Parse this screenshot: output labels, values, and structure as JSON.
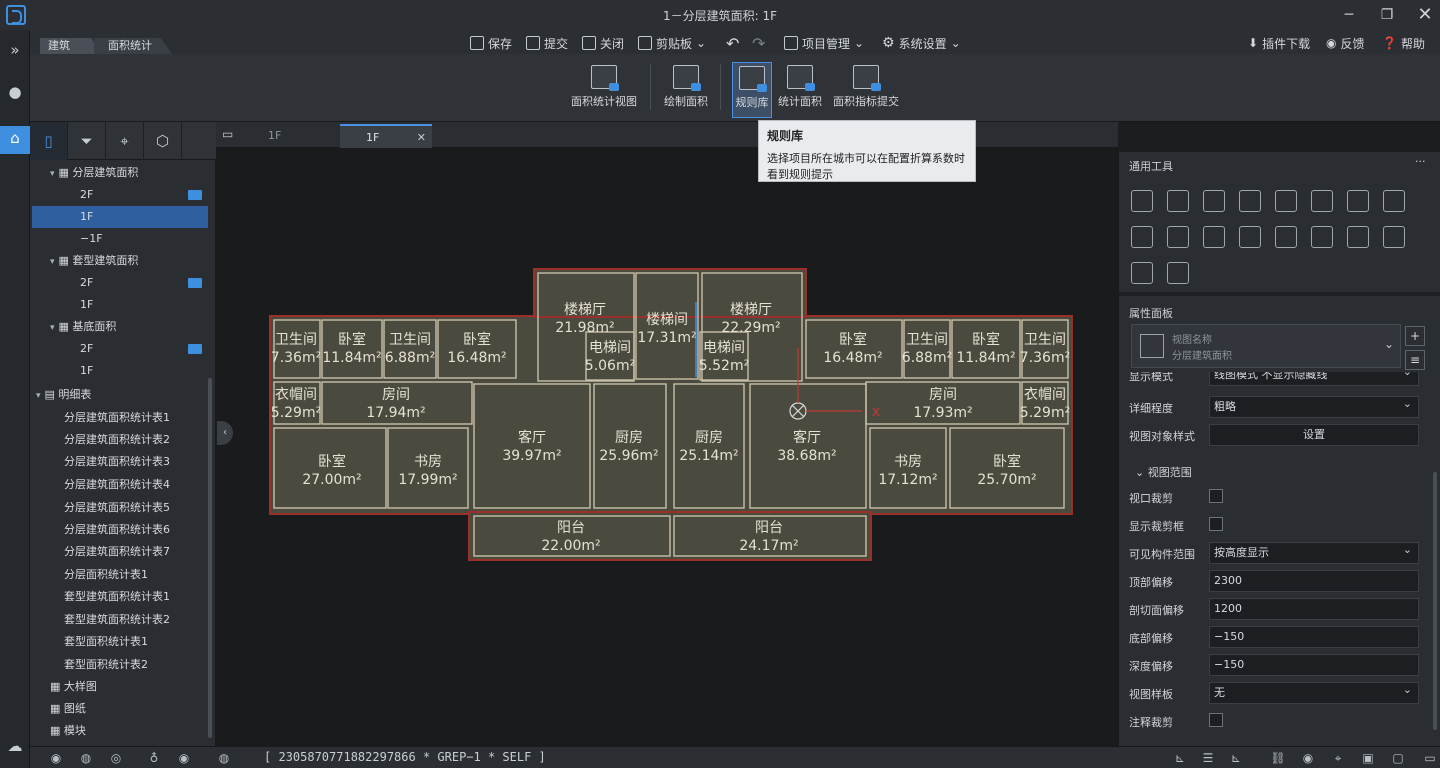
{
  "window": {
    "title": "1－分层建筑面积: 1F"
  },
  "breadcrumb": {
    "arch": "建筑",
    "area": "面积统计"
  },
  "toolbar": {
    "save": "保存",
    "submit": "提交",
    "close": "关闭",
    "clipboard": "剪贴板",
    "project": "项目管理",
    "settings": "系统设置",
    "plugin": "插件下载",
    "feedback": "反馈",
    "help": "帮助"
  },
  "ribbon": {
    "area_view": "面积统计视图",
    "draw_area": "绘制面积",
    "rules": "规则库",
    "stat_area": "统计面积",
    "submit_index": "面积指标提交"
  },
  "tooltip": {
    "title": "规则库",
    "body": "选择项目所在城市可以在配置折算系数时看到规则提示"
  },
  "tree": {
    "layer_area": "分层建筑面积",
    "l_2f": "2F",
    "l_1f": "1F",
    "l_m1f": "−1F",
    "unit_area": "套型建筑面积",
    "u_2f": "2F",
    "u_1f": "1F",
    "base_area": "基底面积",
    "b_2f": "2F",
    "b_1f": "1F",
    "schedule": "明细表",
    "sch": [
      "分层建筑面积统计表1",
      "分层建筑面积统计表2",
      "分层建筑面积统计表3",
      "分层建筑面积统计表4",
      "分层建筑面积统计表5",
      "分层建筑面积统计表6",
      "分层建筑面积统计表7",
      "分层面积统计表1",
      "套型建筑面积统计表1",
      "套型建筑面积统计表2",
      "套型面积统计表1",
      "套型面积统计表2"
    ],
    "detail": "大样图",
    "sheet": "图纸",
    "module": "模块"
  },
  "view_tabs": {
    "tab1": "1F",
    "tab2": "1F"
  },
  "floorplan": {
    "rooms": [
      {
        "name": "卫生间",
        "area": "7.36m²"
      },
      {
        "name": "卧室",
        "area": "11.84m²"
      },
      {
        "name": "卫生间",
        "area": "6.88m²"
      },
      {
        "name": "卧室",
        "area": "16.48m²"
      },
      {
        "name": "楼梯厅",
        "area": "21.98m²"
      },
      {
        "name": "楼梯间",
        "area": "17.31m²"
      },
      {
        "name": "楼梯厅",
        "area": "22.29m²"
      },
      {
        "name": "电梯间",
        "area": "5.06m²"
      },
      {
        "name": "电梯间",
        "area": "5.52m²"
      },
      {
        "name": "卧室",
        "area": "16.48m²"
      },
      {
        "name": "卫生间",
        "area": "6.88m²"
      },
      {
        "name": "卧室",
        "area": "11.84m²"
      },
      {
        "name": "卫生间",
        "area": "7.36m²"
      },
      {
        "name": "衣帽间",
        "area": "5.29m²"
      },
      {
        "name": "房间",
        "area": "17.94m²"
      },
      {
        "name": "房间",
        "area": "17.93m²"
      },
      {
        "name": "衣帽间",
        "area": "5.29m²"
      },
      {
        "name": "客厅",
        "area": "39.97m²"
      },
      {
        "name": "厨房",
        "area": "25.96m²"
      },
      {
        "name": "厨房",
        "area": "25.14m²"
      },
      {
        "name": "客厅",
        "area": "38.68m²"
      },
      {
        "name": "卧室",
        "area": "27.00m²"
      },
      {
        "name": "书房",
        "area": "17.99m²"
      },
      {
        "name": "书房",
        "area": "17.12m²"
      },
      {
        "name": "卧室",
        "area": "25.70m²"
      },
      {
        "name": "阳台",
        "area": "22.00m²"
      },
      {
        "name": "阳台",
        "area": "24.17m²"
      }
    ]
  },
  "tools_panel": {
    "title": "通用工具",
    "more": "···"
  },
  "props": {
    "title": "属性面板",
    "view_name_label": "视图名称",
    "view_name": "分层建筑面积",
    "hidden_row": "显示模式",
    "hidden_val": "线图模式 不显示隐藏线",
    "detail_level_label": "详细程度",
    "detail_level": "粗略",
    "obj_style_label": "视图对象样式",
    "obj_style_btn": "设置",
    "range_section": "视图范围",
    "crop_label": "视口裁剪",
    "show_crop_label": "显示裁剪框",
    "visible_range_label": "可见构件范围",
    "visible_range": "按高度显示",
    "top_offset_label": "顶部偏移",
    "top_offset": "2300",
    "cut_offset_label": "剖切面偏移",
    "cut_offset": "1200",
    "bottom_offset_label": "底部偏移",
    "bottom_offset": "−150",
    "depth_offset_label": "深度偏移",
    "depth_offset": "−150",
    "template_label": "视图样板",
    "template": "无",
    "anno_crop_label": "注释裁剪"
  },
  "status": {
    "text": "[ 2305870771882297866 * GREP−1 * SELF ]"
  }
}
